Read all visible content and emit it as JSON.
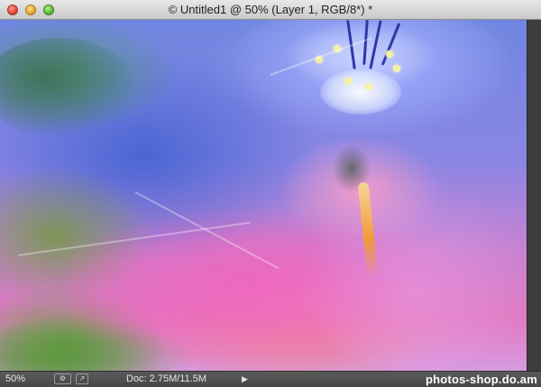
{
  "window": {
    "title": "© Untitled1 @ 50% (Layer 1, RGB/8*) *"
  },
  "canvas": {
    "description_colors": {
      "blue": "#6f86e0",
      "pink": "#e07ac2",
      "green": "#6aa048",
      "orange": "#f09b3a"
    }
  },
  "statusbar": {
    "zoom": "50%",
    "doc_info": "Doc: 2.75M/11.5M",
    "menu_arrow": "▶",
    "watermark": "photos-shop.do.am"
  },
  "icons": {
    "close": "close-icon",
    "minimize": "minimize-icon",
    "maximize": "maximize-icon",
    "doc_status": "document-status-icon",
    "share": "share-icon",
    "menu": "arrow-right-icon"
  }
}
